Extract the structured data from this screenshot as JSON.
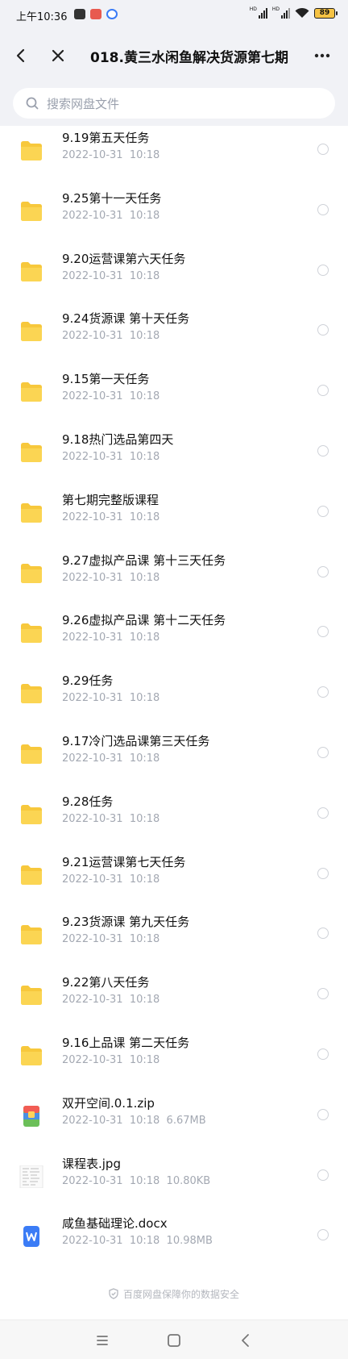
{
  "status_bar": {
    "time": "上午10:36",
    "battery": "89",
    "network_label": "HD"
  },
  "header": {
    "title": "018.黄三水闲鱼解决货源第七期"
  },
  "search": {
    "placeholder": "搜索网盘文件"
  },
  "files": [
    {
      "name": "9.19第五天任务",
      "meta": "2022-10-31  10:18",
      "type": "folder"
    },
    {
      "name": "9.25第十一天任务",
      "meta": "2022-10-31  10:18",
      "type": "folder"
    },
    {
      "name": "9.20运营课第六天任务",
      "meta": "2022-10-31  10:18",
      "type": "folder"
    },
    {
      "name": "9.24货源课 第十天任务",
      "meta": "2022-10-31  10:18",
      "type": "folder"
    },
    {
      "name": "9.15第一天任务",
      "meta": "2022-10-31  10:18",
      "type": "folder"
    },
    {
      "name": "9.18热门选品第四天",
      "meta": "2022-10-31  10:18",
      "type": "folder"
    },
    {
      "name": "第七期完整版课程",
      "meta": "2022-10-31  10:18",
      "type": "folder"
    },
    {
      "name": "9.27虚拟产品课 第十三天任务",
      "meta": "2022-10-31  10:18",
      "type": "folder"
    },
    {
      "name": "9.26虚拟产品课 第十二天任务",
      "meta": "2022-10-31  10:18",
      "type": "folder"
    },
    {
      "name": "9.29任务",
      "meta": "2022-10-31  10:18",
      "type": "folder"
    },
    {
      "name": "9.17冷门选品课第三天任务",
      "meta": "2022-10-31  10:18",
      "type": "folder"
    },
    {
      "name": "9.28任务",
      "meta": "2022-10-31  10:18",
      "type": "folder"
    },
    {
      "name": "9.21运营课第七天任务",
      "meta": "2022-10-31  10:18",
      "type": "folder"
    },
    {
      "name": "9.23货源课 第九天任务",
      "meta": "2022-10-31  10:18",
      "type": "folder"
    },
    {
      "name": "9.22第八天任务",
      "meta": "2022-10-31  10:18",
      "type": "folder"
    },
    {
      "name": "9.16上品课 第二天任务",
      "meta": "2022-10-31  10:18",
      "type": "folder"
    },
    {
      "name": "双开空间.0.1.zip",
      "meta": "2022-10-31  10:18  6.67MB",
      "type": "zip"
    },
    {
      "name": "课程表.jpg",
      "meta": "2022-10-31  10:18  10.80KB",
      "type": "image"
    },
    {
      "name": "咸鱼基础理论.docx",
      "meta": "2022-10-31  10:18  10.98MB",
      "type": "docx"
    }
  ],
  "footer": {
    "text": "百度网盘保障你的数据安全"
  },
  "icons": {
    "back": "back-arrow-icon",
    "close": "close-icon",
    "more": "more-icon",
    "search": "search-icon",
    "folder": "folder-icon",
    "zip": "zip-file-icon",
    "image": "image-file-icon",
    "docx": "word-file-icon",
    "shield": "shield-icon"
  },
  "colors": {
    "folder": "#f7c83c",
    "accent": "#3b7cf6",
    "header_bg": "#f1f2f6",
    "meta_text": "#a3a8b2"
  }
}
